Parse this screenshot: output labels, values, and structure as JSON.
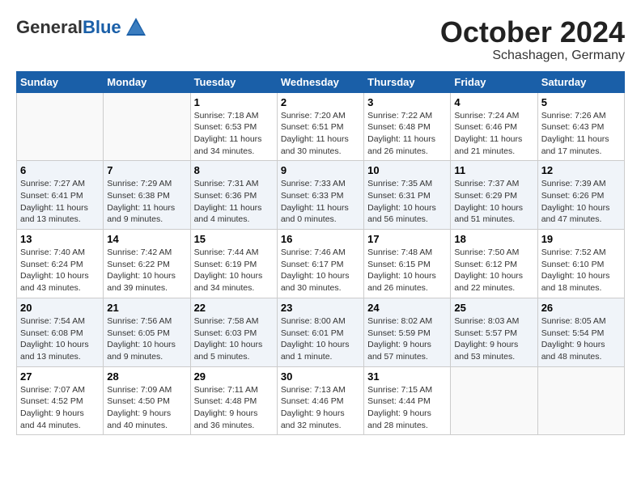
{
  "logo": {
    "general": "General",
    "blue": "Blue"
  },
  "title": "October 2024",
  "location": "Schashagen, Germany",
  "days": [
    "Sunday",
    "Monday",
    "Tuesday",
    "Wednesday",
    "Thursday",
    "Friday",
    "Saturday"
  ],
  "weeks": [
    [
      {
        "day": "",
        "content": ""
      },
      {
        "day": "",
        "content": ""
      },
      {
        "day": "1",
        "content": "Sunrise: 7:18 AM\nSunset: 6:53 PM\nDaylight: 11 hours\nand 34 minutes."
      },
      {
        "day": "2",
        "content": "Sunrise: 7:20 AM\nSunset: 6:51 PM\nDaylight: 11 hours\nand 30 minutes."
      },
      {
        "day": "3",
        "content": "Sunrise: 7:22 AM\nSunset: 6:48 PM\nDaylight: 11 hours\nand 26 minutes."
      },
      {
        "day": "4",
        "content": "Sunrise: 7:24 AM\nSunset: 6:46 PM\nDaylight: 11 hours\nand 21 minutes."
      },
      {
        "day": "5",
        "content": "Sunrise: 7:26 AM\nSunset: 6:43 PM\nDaylight: 11 hours\nand 17 minutes."
      }
    ],
    [
      {
        "day": "6",
        "content": "Sunrise: 7:27 AM\nSunset: 6:41 PM\nDaylight: 11 hours\nand 13 minutes."
      },
      {
        "day": "7",
        "content": "Sunrise: 7:29 AM\nSunset: 6:38 PM\nDaylight: 11 hours\nand 9 minutes."
      },
      {
        "day": "8",
        "content": "Sunrise: 7:31 AM\nSunset: 6:36 PM\nDaylight: 11 hours\nand 4 minutes."
      },
      {
        "day": "9",
        "content": "Sunrise: 7:33 AM\nSunset: 6:33 PM\nDaylight: 11 hours\nand 0 minutes."
      },
      {
        "day": "10",
        "content": "Sunrise: 7:35 AM\nSunset: 6:31 PM\nDaylight: 10 hours\nand 56 minutes."
      },
      {
        "day": "11",
        "content": "Sunrise: 7:37 AM\nSunset: 6:29 PM\nDaylight: 10 hours\nand 51 minutes."
      },
      {
        "day": "12",
        "content": "Sunrise: 7:39 AM\nSunset: 6:26 PM\nDaylight: 10 hours\nand 47 minutes."
      }
    ],
    [
      {
        "day": "13",
        "content": "Sunrise: 7:40 AM\nSunset: 6:24 PM\nDaylight: 10 hours\nand 43 minutes."
      },
      {
        "day": "14",
        "content": "Sunrise: 7:42 AM\nSunset: 6:22 PM\nDaylight: 10 hours\nand 39 minutes."
      },
      {
        "day": "15",
        "content": "Sunrise: 7:44 AM\nSunset: 6:19 PM\nDaylight: 10 hours\nand 34 minutes."
      },
      {
        "day": "16",
        "content": "Sunrise: 7:46 AM\nSunset: 6:17 PM\nDaylight: 10 hours\nand 30 minutes."
      },
      {
        "day": "17",
        "content": "Sunrise: 7:48 AM\nSunset: 6:15 PM\nDaylight: 10 hours\nand 26 minutes."
      },
      {
        "day": "18",
        "content": "Sunrise: 7:50 AM\nSunset: 6:12 PM\nDaylight: 10 hours\nand 22 minutes."
      },
      {
        "day": "19",
        "content": "Sunrise: 7:52 AM\nSunset: 6:10 PM\nDaylight: 10 hours\nand 18 minutes."
      }
    ],
    [
      {
        "day": "20",
        "content": "Sunrise: 7:54 AM\nSunset: 6:08 PM\nDaylight: 10 hours\nand 13 minutes."
      },
      {
        "day": "21",
        "content": "Sunrise: 7:56 AM\nSunset: 6:05 PM\nDaylight: 10 hours\nand 9 minutes."
      },
      {
        "day": "22",
        "content": "Sunrise: 7:58 AM\nSunset: 6:03 PM\nDaylight: 10 hours\nand 5 minutes."
      },
      {
        "day": "23",
        "content": "Sunrise: 8:00 AM\nSunset: 6:01 PM\nDaylight: 10 hours\nand 1 minute."
      },
      {
        "day": "24",
        "content": "Sunrise: 8:02 AM\nSunset: 5:59 PM\nDaylight: 9 hours\nand 57 minutes."
      },
      {
        "day": "25",
        "content": "Sunrise: 8:03 AM\nSunset: 5:57 PM\nDaylight: 9 hours\nand 53 minutes."
      },
      {
        "day": "26",
        "content": "Sunrise: 8:05 AM\nSunset: 5:54 PM\nDaylight: 9 hours\nand 48 minutes."
      }
    ],
    [
      {
        "day": "27",
        "content": "Sunrise: 7:07 AM\nSunset: 4:52 PM\nDaylight: 9 hours\nand 44 minutes."
      },
      {
        "day": "28",
        "content": "Sunrise: 7:09 AM\nSunset: 4:50 PM\nDaylight: 9 hours\nand 40 minutes."
      },
      {
        "day": "29",
        "content": "Sunrise: 7:11 AM\nSunset: 4:48 PM\nDaylight: 9 hours\nand 36 minutes."
      },
      {
        "day": "30",
        "content": "Sunrise: 7:13 AM\nSunset: 4:46 PM\nDaylight: 9 hours\nand 32 minutes."
      },
      {
        "day": "31",
        "content": "Sunrise: 7:15 AM\nSunset: 4:44 PM\nDaylight: 9 hours\nand 28 minutes."
      },
      {
        "day": "",
        "content": ""
      },
      {
        "day": "",
        "content": ""
      }
    ]
  ]
}
